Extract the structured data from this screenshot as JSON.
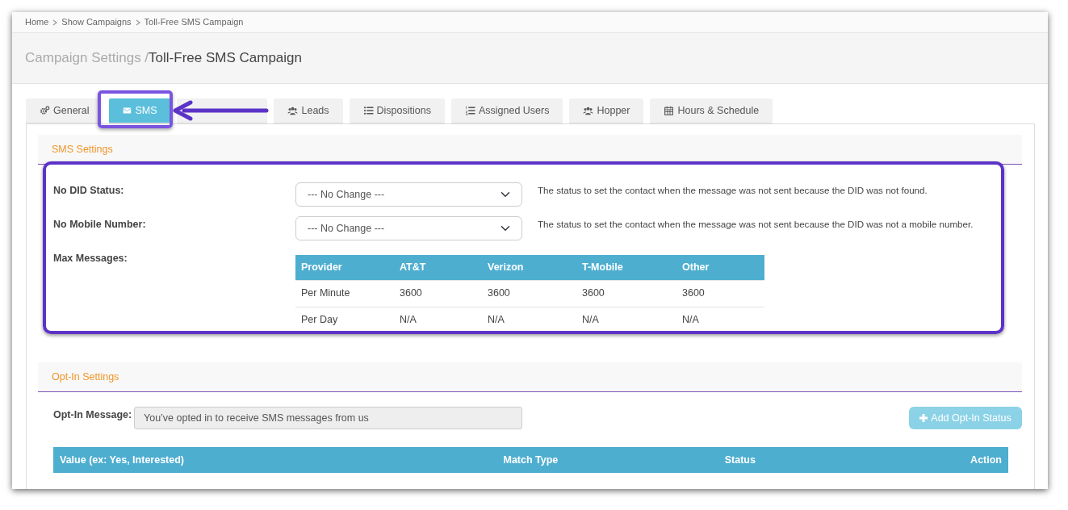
{
  "breadcrumb": [
    {
      "label": "Home"
    },
    {
      "label": "Show Campaigns"
    },
    {
      "label": "Toll-Free SMS Campaign"
    }
  ],
  "page_title": {
    "parent": "Campaign Settings",
    "separator": "/",
    "current": "Toll-Free SMS Campaign"
  },
  "tabs": [
    {
      "label": "General",
      "selected": false
    },
    {
      "label": "SMS",
      "selected": true
    },
    {
      "selected": false
    },
    {
      "label": "Leads",
      "selected": false
    },
    {
      "label": "Dispositions",
      "selected": false
    },
    {
      "label": "Assigned Users",
      "selected": false
    },
    {
      "label": "Hopper",
      "selected": false
    },
    {
      "label": "Hours & Schedule",
      "selected": false
    }
  ],
  "sms_settings": {
    "title": "SMS Settings",
    "fields": [
      {
        "label": "No DID Status:",
        "value": "--- No Change ---",
        "help": "The status to set the contact when the message was not sent because the DID was not found."
      },
      {
        "label": "No Mobile Number:",
        "value": "--- No Change ---",
        "help": "The status to set the contact when the message was not sent because the DID was not a mobile number."
      }
    ],
    "max_messages": {
      "label": "Max Messages:",
      "columns": [
        "Provider",
        "AT&T",
        "Verizon",
        "T-Mobile",
        "Other"
      ],
      "rows": [
        [
          "Per Minute",
          "3600",
          "3600",
          "3600",
          "3600"
        ],
        [
          "Per Day",
          "N/A",
          "N/A",
          "N/A",
          "N/A"
        ]
      ]
    }
  },
  "opt_in": {
    "title": "Opt-In Settings",
    "label": "Opt-In Message:",
    "value": "You’ve opted in to receive SMS messages from us",
    "add_button": {
      "label": "Add Opt-In Status",
      "disabled": true
    },
    "columns": [
      "Value (ex: Yes, Interested)",
      "Match Type",
      "Status",
      "Action"
    ]
  },
  "annotations": [
    {
      "kind": "tab-frame"
    },
    {
      "kind": "arrow"
    },
    {
      "kind": "section-frame"
    }
  ]
}
